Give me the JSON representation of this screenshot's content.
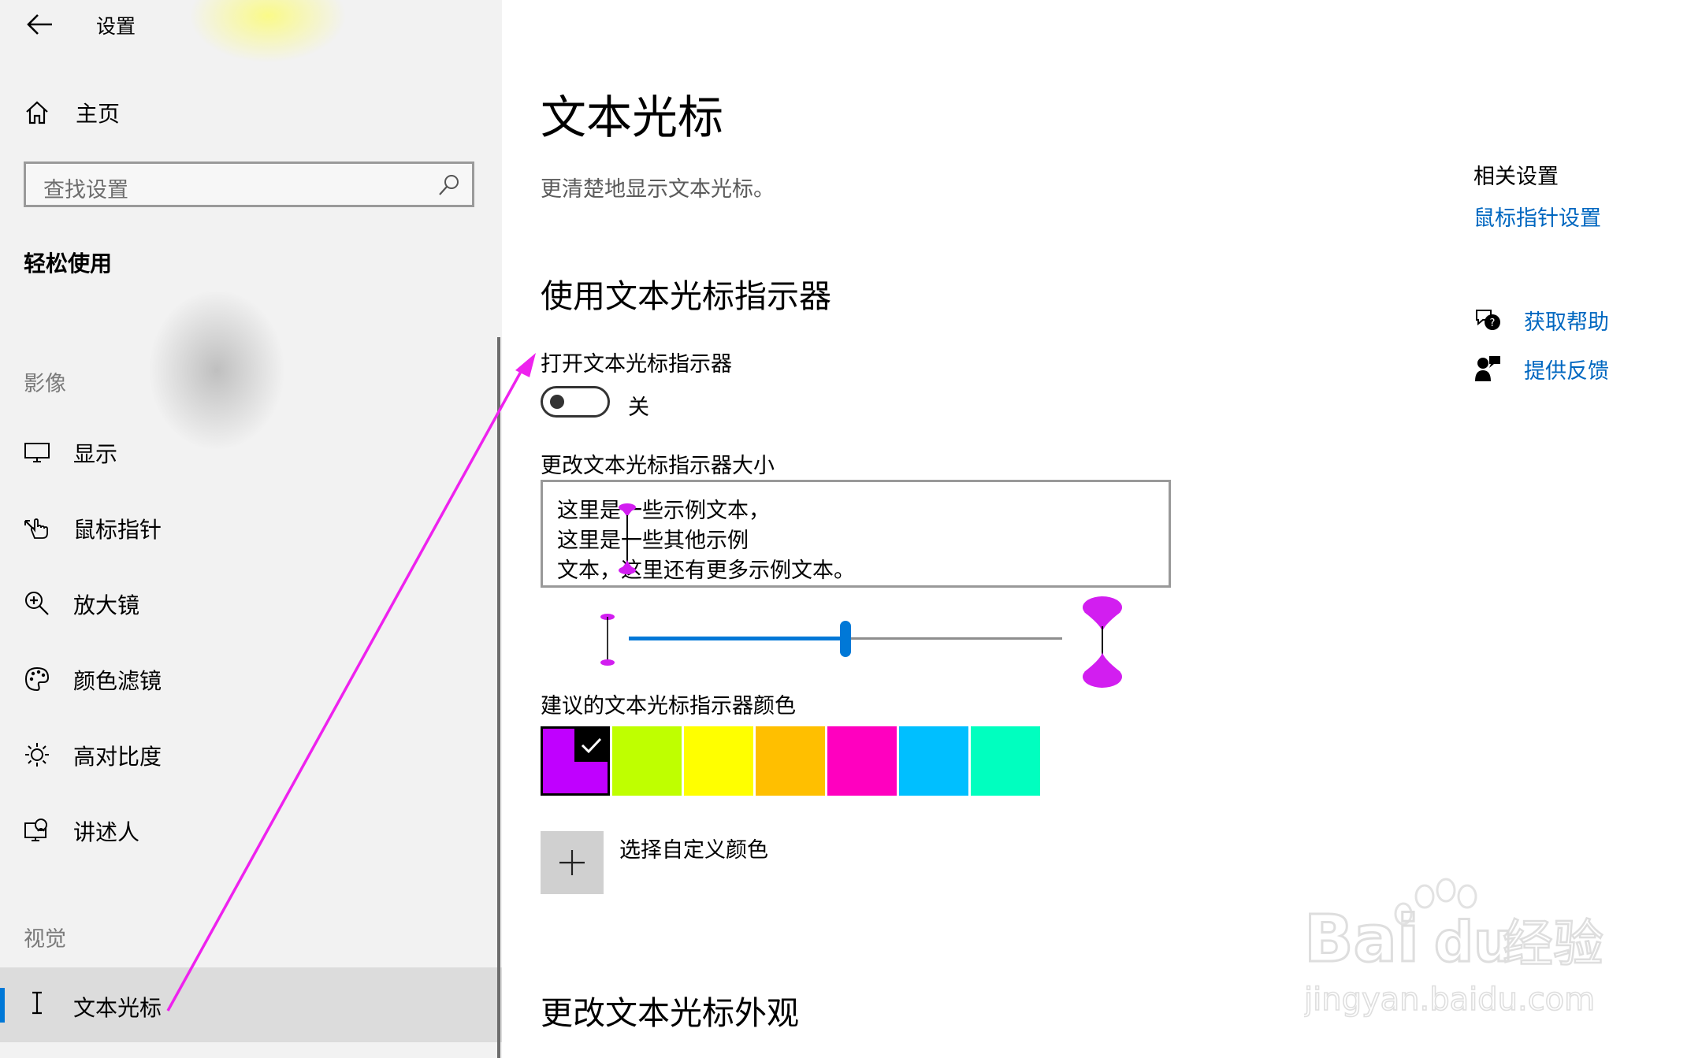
{
  "window": {
    "title": "设置"
  },
  "sidebar": {
    "home_label": "主页",
    "search_placeholder": "查找设置",
    "category_title": "轻松使用",
    "group_vision": "影像",
    "items": [
      {
        "label": "显示",
        "icon": "monitor-icon"
      },
      {
        "label": "鼠标指针",
        "icon": "pointer-hand-icon"
      },
      {
        "label": "放大镜",
        "icon": "magnifier-icon"
      },
      {
        "label": "颜色滤镜",
        "icon": "palette-icon"
      },
      {
        "label": "高对比度",
        "icon": "sun-icon"
      },
      {
        "label": "讲述人",
        "icon": "narrator-icon"
      }
    ],
    "group_visual": "视觉",
    "selected_item": {
      "label": "文本光标",
      "icon": "text-cursor-icon"
    }
  },
  "main": {
    "title": "文本光标",
    "subtitle": "更清楚地显示文本光标。",
    "indicator_section_title": "使用文本光标指示器",
    "toggle_label": "打开文本光标指示器",
    "toggle_state": "关",
    "size_label": "更改文本光标指示器大小",
    "sample_lines": [
      "这里是一些示例文本，",
      "这里是一些其他示例",
      "文本，这里还有更多示例文本。"
    ],
    "slider_value": 0.5,
    "colors_label": "建议的文本光标指示器颜色",
    "colors": [
      "#c000ff",
      "#bfff00",
      "#ffff00",
      "#ffbf00",
      "#ff00bf",
      "#00bfff",
      "#00ffbf"
    ],
    "selected_color_index": 0,
    "custom_color_label": "选择自定义颜色",
    "appearance_section_title": "更改文本光标外观"
  },
  "related": {
    "title": "相关设置",
    "mouse_link": "鼠标指针设置",
    "help_label": "获取帮助",
    "feedback_label": "提供反馈"
  },
  "colors": {
    "accent": "#0078d7",
    "link": "#0067c0",
    "annotation_arrow": "#ee22ee"
  }
}
